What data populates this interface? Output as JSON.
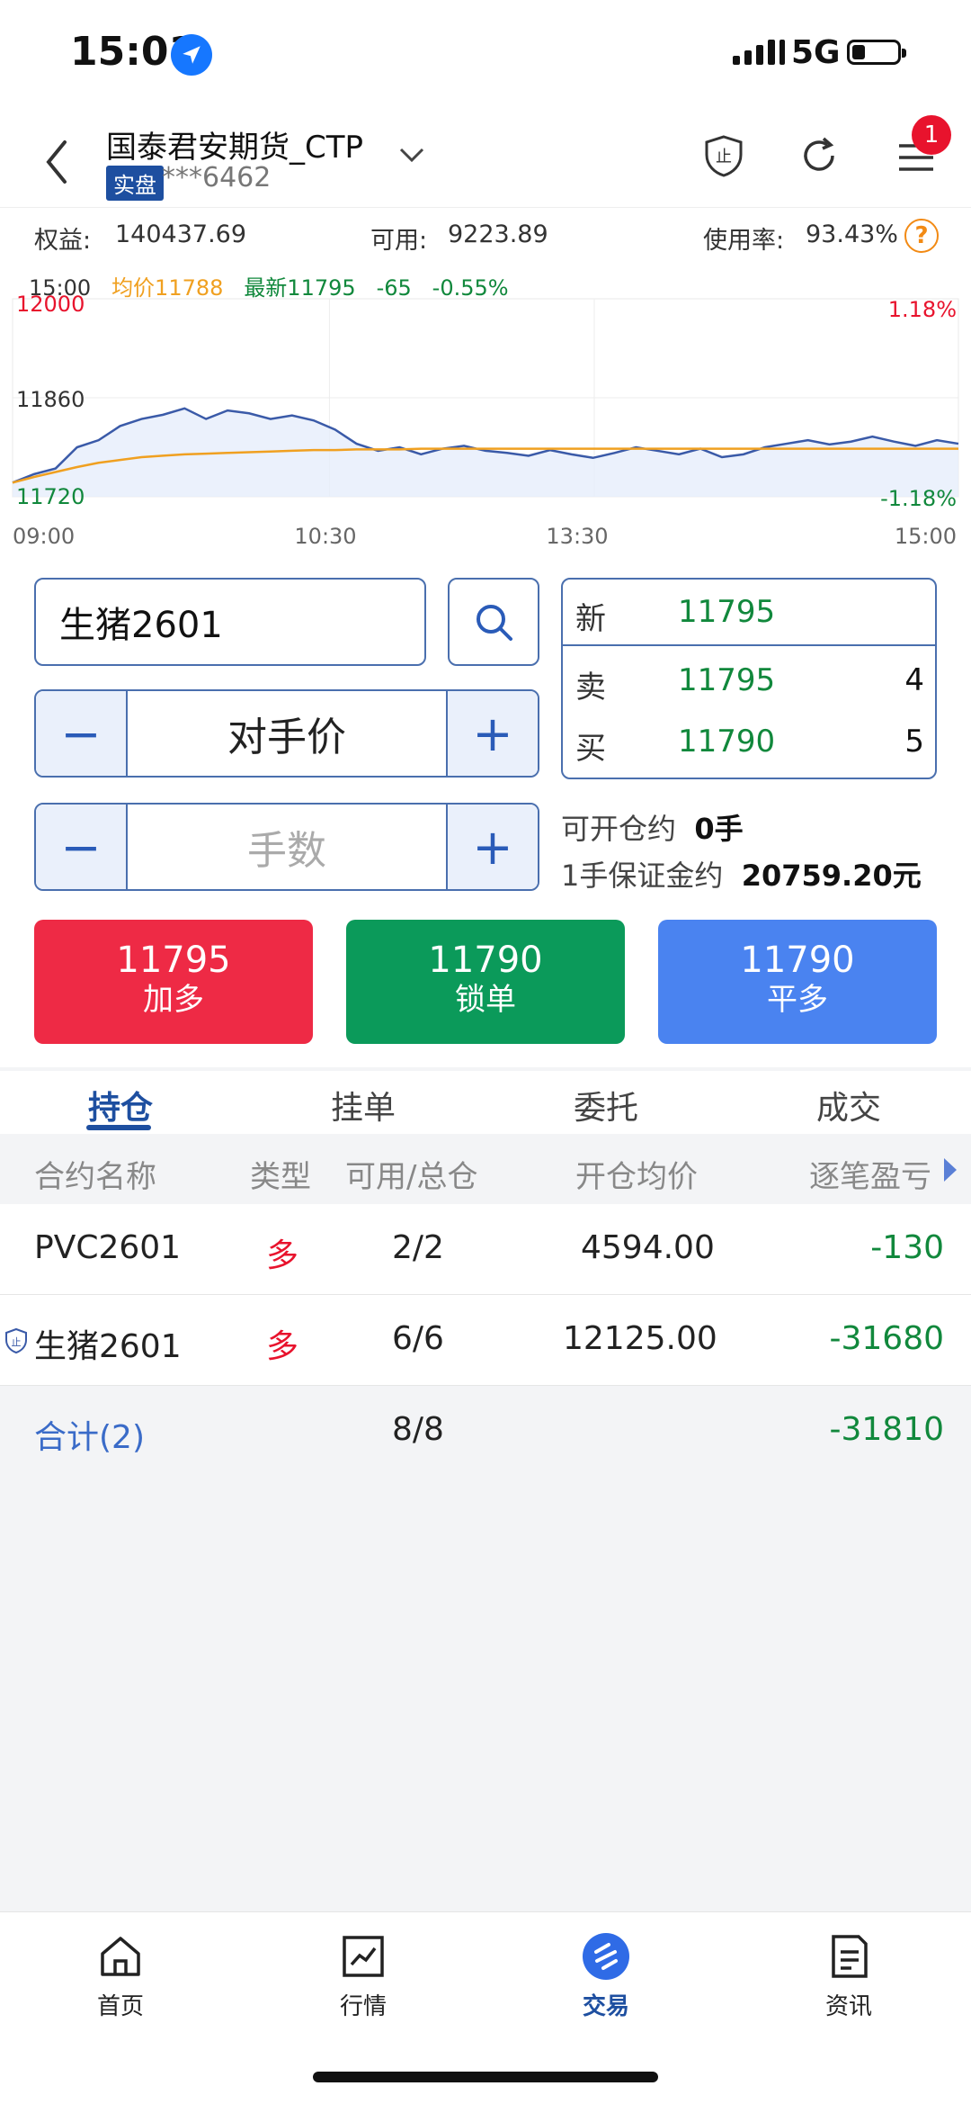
{
  "status": {
    "time": "15:01",
    "network": "5G"
  },
  "header": {
    "account_name": "国泰君安期货_CTP",
    "account_tag": "实盘",
    "account_number": "***6462",
    "menu_badge": "1"
  },
  "summary": {
    "equity_label": "权益:",
    "equity_value": "140437.69",
    "available_label": "可用:",
    "available_value": "9223.89",
    "usage_label": "使用率:",
    "usage_value": "93.43%",
    "help": "?"
  },
  "chart_header": {
    "time": "15:00",
    "avg": "均价11788",
    "last": "最新11795",
    "change": "-65",
    "change_pct": "-0.55%"
  },
  "chart_data": {
    "type": "line",
    "x_ticks": [
      "09:00",
      "10:30",
      "13:30",
      "15:00"
    ],
    "y_ticks": [
      "12000",
      "11860",
      "11720"
    ],
    "pct_ticks": [
      "1.18%",
      "-1.18%"
    ],
    "ylim": [
      11720,
      12000
    ],
    "series": [
      {
        "values": [
          11740,
          11752,
          11760,
          11790,
          11800,
          11820,
          11830,
          11836,
          11845,
          11830,
          11842,
          11838,
          11830,
          11835,
          11828,
          11815,
          11795,
          11785,
          11790,
          11780,
          11788,
          11792,
          11785,
          11782,
          11778,
          11786,
          11780,
          11775,
          11782,
          11790,
          11785,
          11780,
          11788,
          11776,
          11780,
          11790,
          11795,
          11800,
          11794,
          11798,
          11805,
          11798,
          11792,
          11800,
          11795
        ]
      },
      {
        "values": [
          11740,
          11748,
          11755,
          11762,
          11768,
          11772,
          11776,
          11778,
          11780,
          11781,
          11782,
          11783,
          11784,
          11785,
          11786,
          11786,
          11787,
          11787,
          11787,
          11788,
          11788,
          11788,
          11788,
          11788,
          11788,
          11788,
          11788,
          11788,
          11788,
          11788,
          11788,
          11788,
          11788,
          11788,
          11788,
          11788,
          11788,
          11788,
          11788,
          11788,
          11788,
          11788,
          11788,
          11788,
          11788
        ]
      }
    ],
    "colors": {
      "price": "#3a5aa8",
      "avg": "#f0a020",
      "up": "#e8132d",
      "down": "#11883c"
    }
  },
  "order": {
    "symbol": "生猪2601",
    "price_mode": "对手价",
    "lots_placeholder": "手数",
    "minus": "−",
    "plus": "+",
    "open_label": "可开仓约",
    "open_value": "0手",
    "margin_label": "1手保证金约",
    "margin_value": "20759.20元"
  },
  "quote": {
    "new_label": "新",
    "new_price": "11795",
    "sell_label": "卖",
    "sell_price": "11795",
    "sell_qty": "4",
    "buy_label": "买",
    "buy_price": "11790",
    "buy_qty": "5"
  },
  "actions": [
    {
      "price": "11795",
      "label": "加多",
      "color": "#ee2a45"
    },
    {
      "price": "11790",
      "label": "锁单",
      "color": "#0b9a5a"
    },
    {
      "price": "11790",
      "label": "平多",
      "color": "#4a83f0"
    }
  ],
  "tabs": [
    "持仓",
    "挂单",
    "委托",
    "成交"
  ],
  "table": {
    "headers": [
      "合约名称",
      "类型",
      "可用/总仓",
      "开仓均价",
      "逐笔盈亏"
    ],
    "rows": [
      {
        "name": "PVC2601",
        "type": "多",
        "qty": "2/2",
        "avg": "4594.00",
        "pnl": "-130"
      },
      {
        "name": "生猪2601",
        "type": "多",
        "qty": "6/6",
        "avg": "12125.00",
        "pnl": "-31680"
      }
    ],
    "total_label": "合计(2)",
    "total_qty": "8/8",
    "total_pnl": "-31810"
  },
  "nav": [
    "首页",
    "行情",
    "交易",
    "资讯"
  ]
}
